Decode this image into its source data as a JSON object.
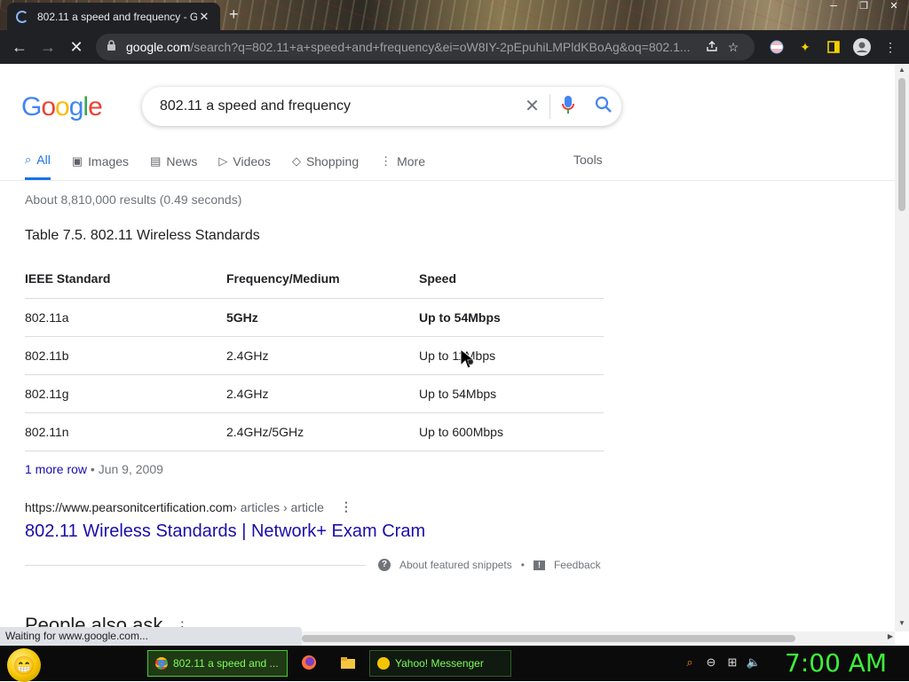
{
  "browser": {
    "tab_title": "802.11 a speed and frequency - G",
    "new_tab_label": "+",
    "omnibox": {
      "host": "google.com",
      "rest": "/search?q=802.11+a+speed+and+frequency&ei=oW8IY-2pEpuhiLMPldKBoAg&oq=802.1..."
    }
  },
  "search": {
    "query": "802.11 a speed and frequency",
    "tabs": [
      {
        "label": "All",
        "icon": "search-icon"
      },
      {
        "label": "Images",
        "icon": "image-icon"
      },
      {
        "label": "News",
        "icon": "news-icon"
      },
      {
        "label": "Videos",
        "icon": "video-icon"
      },
      {
        "label": "Shopping",
        "icon": "tag-icon"
      },
      {
        "label": "More",
        "icon": "more-vert-icon"
      }
    ],
    "tools_label": "Tools",
    "stats": "About 8,810,000 results (0.49 seconds)"
  },
  "snippet": {
    "title": "Table 7.5. 802.11 Wireless Standards",
    "headers": [
      "IEEE Standard",
      "Frequency/Medium",
      "Speed"
    ],
    "rows": [
      [
        "802.11a",
        "5GHz",
        "Up to 54Mbps"
      ],
      [
        "802.11b",
        "2.4GHz",
        "Up to 11Mbps"
      ],
      [
        "802.11g",
        "2.4GHz",
        "Up to 54Mbps"
      ],
      [
        "802.11n",
        "2.4GHz/5GHz",
        "Up to 600Mbps"
      ]
    ],
    "more_row": "1 more row",
    "date": "Jun 9, 2009",
    "source_host": "https://www.pearsonitcertification.com",
    "source_path": " › articles › article",
    "result_title": "802.11 Wireless Standards | Network+ Exam Cram",
    "about_label": "About featured snippets",
    "feedback_label": "Feedback"
  },
  "people_also_ask": "People also ask",
  "status_text": "Waiting for www.google.com...",
  "taskbar": {
    "tasks": [
      {
        "label": "802.11 a speed and ..."
      },
      {
        "label": "Yahoo! Messenger"
      }
    ],
    "clock": "7:00 AM"
  },
  "colors": {
    "link": "#1a0dab",
    "accent": "#1a73e8",
    "clock": "#3cf03c"
  }
}
